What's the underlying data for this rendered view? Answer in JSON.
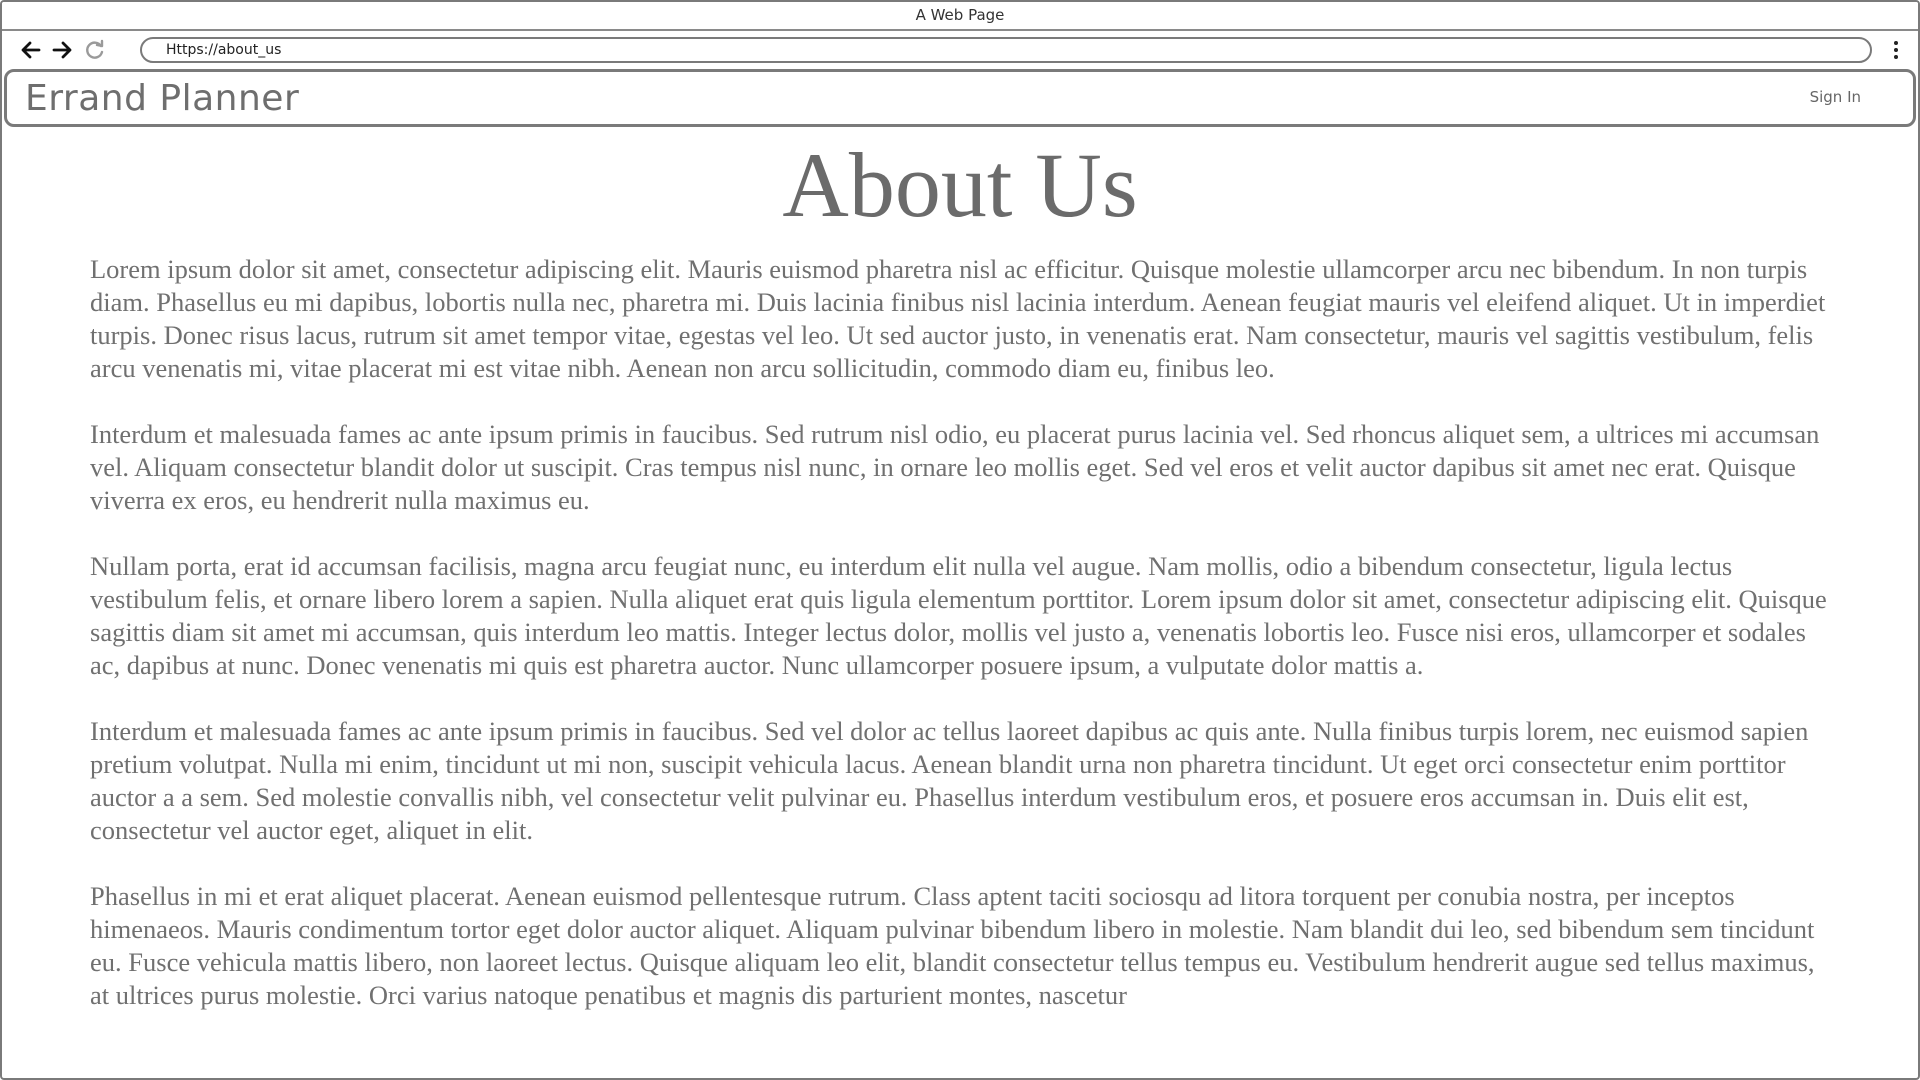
{
  "browser": {
    "window_title": "A Web Page",
    "address": "Https://about_us",
    "icons": {
      "back": "arrow-left-icon",
      "forward": "arrow-right-icon",
      "reload": "reload-icon",
      "menu": "vertical-dots-icon"
    }
  },
  "site": {
    "logo": "Errand Planner",
    "signin_label": "Sign In"
  },
  "page": {
    "heading": "About Us",
    "paragraphs": [
      "Lorem ipsum dolor sit amet, consectetur adipiscing elit. Mauris euismod pharetra nisl ac efficitur. Quisque molestie ullamcorper arcu nec bibendum. In non turpis diam. Phasellus eu mi dapibus, lobortis nulla nec, pharetra mi. Duis lacinia finibus nisl lacinia interdum. Aenean feugiat mauris vel eleifend aliquet. Ut in imperdiet turpis. Donec risus lacus, rutrum sit amet tempor vitae, egestas vel leo. Ut sed auctor justo, in venenatis erat. Nam consectetur, mauris vel sagittis vestibulum, felis arcu venenatis mi, vitae placerat mi est vitae nibh. Aenean non arcu sollicitudin, commodo diam eu, finibus leo.",
      "Interdum et malesuada fames ac ante ipsum primis in faucibus. Sed rutrum nisl odio, eu placerat purus lacinia vel. Sed rhoncus aliquet sem, a ultrices mi accumsan vel. Aliquam consectetur blandit dolor ut suscipit. Cras tempus nisl nunc, in ornare leo mollis eget. Sed vel eros et velit auctor dapibus sit amet nec erat. Quisque viverra ex eros, eu hendrerit nulla maximus eu.",
      "Nullam porta, erat id accumsan facilisis, magna arcu feugiat nunc, eu interdum elit nulla vel augue. Nam mollis, odio a bibendum consectetur, ligula lectus vestibulum felis, et ornare libero lorem a sapien. Nulla aliquet erat quis ligula elementum porttitor. Lorem ipsum dolor sit amet, consectetur adipiscing elit. Quisque sagittis diam sit amet mi accumsan, quis interdum leo mattis. Integer lectus dolor, mollis vel justo a, venenatis lobortis leo. Fusce nisi eros, ullamcorper et sodales ac, dapibus at nunc. Donec venenatis mi quis est pharetra auctor. Nunc ullamcorper posuere ipsum, a vulputate dolor mattis a.",
      "Interdum et malesuada fames ac ante ipsum primis in faucibus. Sed vel dolor ac tellus laoreet dapibus ac quis ante. Nulla finibus turpis lorem, nec euismod sapien pretium volutpat. Nulla mi enim, tincidunt ut mi non, suscipit vehicula lacus. Aenean blandit urna non pharetra tincidunt. Ut eget orci consectetur enim porttitor auctor a a sem. Sed molestie convallis nibh, vel consectetur velit pulvinar eu. Phasellus interdum vestibulum eros, et posuere eros accumsan in. Duis elit est, consectetur vel auctor eget, aliquet in elit.",
      "Phasellus in mi et erat aliquet placerat. Aenean euismod pellentesque rutrum. Class aptent taciti sociosqu ad litora torquent per conubia nostra, per inceptos himenaeos. Mauris condimentum tortor eget dolor auctor aliquet. Aliquam pulvinar bibendum libero in molestie. Nam blandit dui leo, sed bibendum sem tincidunt eu. Fusce vehicula mattis libero, non laoreet lectus. Quisque aliquam leo elit, blandit consectetur tellus tempus eu. Vestibulum hendrerit augue sed tellus maximus, at ultrices purus molestie. Orci varius natoque penatibus et magnis dis parturient montes, nascetur"
    ]
  },
  "colors": {
    "border": "#7a7a7a",
    "text": "#707070",
    "heading": "#6b6b6b",
    "background": "#ffffff"
  }
}
